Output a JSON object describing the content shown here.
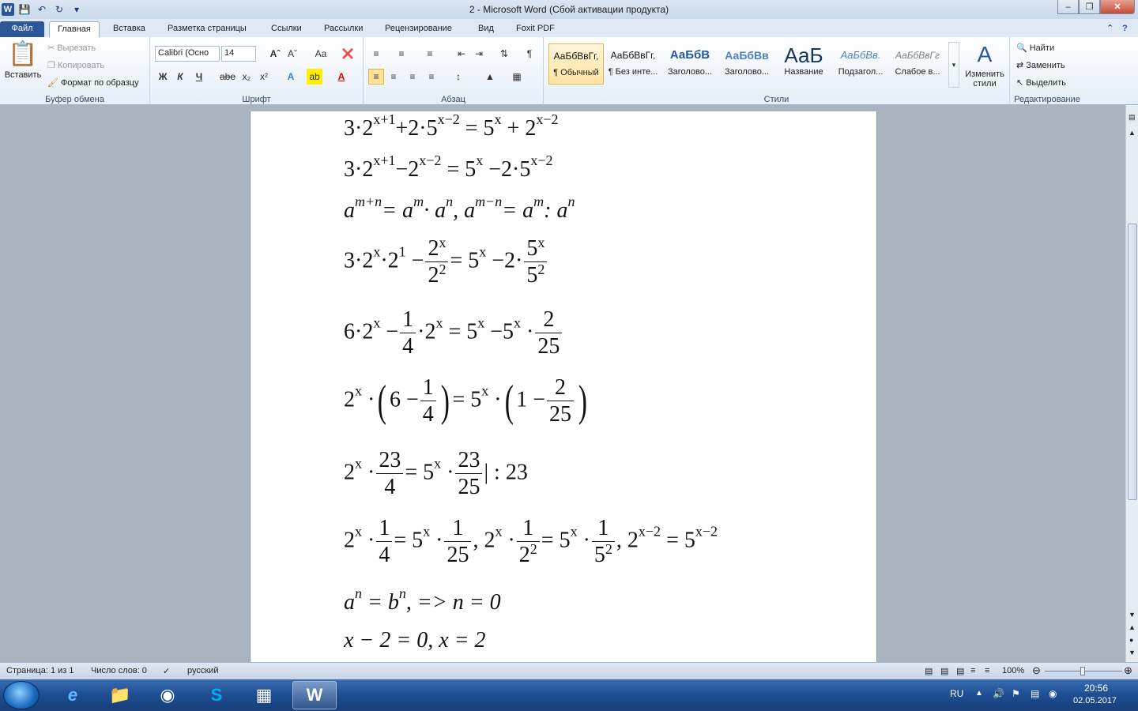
{
  "window": {
    "title": "2  -  Microsoft Word (Сбой активации продукта)"
  },
  "tabs": [
    "Файл",
    "Главная",
    "Вставка",
    "Разметка страницы",
    "Ссылки",
    "Рассылки",
    "Рецензирование",
    "Вид",
    "Foxit PDF"
  ],
  "clipboard": {
    "paste": "Вставить",
    "cut": "Вырезать",
    "copy": "Копировать",
    "format_painter": "Формат по образцу",
    "label": "Буфер обмена"
  },
  "font": {
    "name": "Calibri (Осно",
    "size": "14",
    "label": "Шрифт",
    "bold": "Ж",
    "italic": "К",
    "underline": "Ч",
    "strike": "abe",
    "sub": "x₂",
    "sup": "x²",
    "grow": "A",
    "case": "Aa"
  },
  "paragraph": {
    "label": "Абзац"
  },
  "styles": {
    "label": "Стили",
    "change": "Изменить стили",
    "items": [
      {
        "preview": "АаБбВвГг,",
        "name": "¶ Обычный"
      },
      {
        "preview": "АаБбВвГг,",
        "name": "¶ Без инте..."
      },
      {
        "preview": "АаБбВ",
        "name": "Заголово..."
      },
      {
        "preview": "АаБбВв",
        "name": "Заголово..."
      },
      {
        "preview": "АаБ",
        "name": "Название"
      },
      {
        "preview": "АаБбВв.",
        "name": "Подзагол..."
      },
      {
        "preview": "АаБбВвГг",
        "name": "Слабое в..."
      }
    ]
  },
  "editing": {
    "find": "Найти",
    "replace": "Заменить",
    "select": "Выделить",
    "label": "Редактирование"
  },
  "status": {
    "page": "Страница: 1 из 1",
    "words": "Число слов: 0",
    "lang": "русский",
    "zoom": "100%"
  },
  "tray": {
    "lang": "RU",
    "time": "20:56",
    "date": "02.05.2017"
  },
  "equations": {
    "e1": {
      "a": "3·2",
      "b": "x+1",
      "c": "+2·5",
      "d": "x−2",
      "e": "= 5",
      "f": "x",
      "g": "+ 2",
      "h": "x−2"
    },
    "e2": {
      "a": "3·2",
      "b": "x+1",
      "c": "−2",
      "d": "x−2",
      "e": "= 5",
      "f": "x",
      "g": "−2·5",
      "h": "x−2"
    },
    "e3": {
      "a": "a",
      "b": "m+n",
      "c": "= a",
      "d": "m",
      "e": "· a",
      "f": "n",
      "g": ",    a",
      "h": "m−n",
      "i": "= a",
      "j": "m",
      "k": ": a",
      "l": "n"
    },
    "e4": {
      "a": "3·2",
      "b": "x",
      "c": "·2",
      "d": "1",
      "e": "−",
      "fn": "2",
      "fnx": "x",
      "fd": "2",
      "fdx": "2",
      "g": "= 5",
      "h": "x",
      "i": "−2·",
      "gn": "5",
      "gnx": "x",
      "gd": "5",
      "gdx": "2"
    },
    "e5": {
      "a": "6·2",
      "b": "x",
      "c": "−",
      "fn": "1",
      "fd": "4",
      "d": "·2",
      "e": "x",
      "f": "= 5",
      "g": "x",
      "h": "−5",
      "i": "x",
      "j": "·",
      "gn": "2",
      "gd": "25"
    },
    "e6": {
      "a": "2",
      "b": "x",
      "c": "·",
      "d": "6 −",
      "fn": "1",
      "fd": "4",
      "e": "= 5",
      "f": "x",
      "g": "·",
      "h": "1 −",
      "gn": "2",
      "gd": "25"
    },
    "e7": {
      "a": "2",
      "b": "x",
      "c": "·",
      "fn": "23",
      "fd": "4",
      "d": "= 5",
      "e": "x",
      "f": "·",
      "gn": "23",
      "gd": "25",
      "g": "| : 23"
    },
    "e8": {
      "a": "2",
      "b": "x",
      "c": "·",
      "fn": "1",
      "fd": "4",
      "d": "= 5",
      "e": "x",
      "f": "·",
      "gn": "1",
      "gd": "25",
      "g": ",    2",
      "h": "x",
      "i": "·",
      "hn": "1",
      "hd": "2",
      "hdx": "2",
      "j": "= 5",
      "k": "x",
      "l": "·",
      "in": "1",
      "id": "5",
      "idx": "2",
      "m": ",    2",
      "n": "x−2",
      "o": "= 5",
      "p": "x−2"
    },
    "e9": {
      "a": "a",
      "b": "n",
      "c": "= b",
      "d": "n",
      "e": ", =>    n = 0"
    },
    "e10": {
      "a": "x − 2 = 0,    x = 2"
    }
  }
}
